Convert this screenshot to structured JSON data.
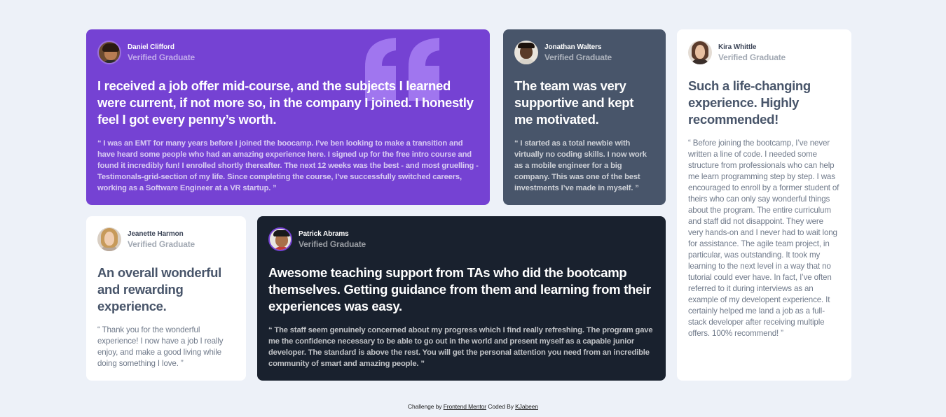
{
  "cards": {
    "daniel": {
      "name": "Daniel Clifford",
      "role": "Verified Graduate",
      "headline": "I received a job offer mid-course, and the subjects I learned were current, if not more so, in the company I joined. I honestly feel I got every penny’s worth.",
      "quote": "“ I was an EMT for many years before I joined the boocamp. I’ve ben looking to make a transition and have heard some people who had an amazing experience here. I signed up for the free intro course and found it incredibly fun! I enrolled shortly thereafter. The next 12 weeks was the best - and most gruelling - Testimonals-grid-section of my life. Since completing the course, I’ve successfully switched careers, working as a Software Engineer at a VR startup. ”"
    },
    "jonathan": {
      "name": "Jonathan Walters",
      "role": "Verified Graduate",
      "headline": "The team was very supportive and kept me motivated.",
      "quote": "“ I started as a total newbie with virtually no coding skills. I now work as a mobile engineer for a big company. This was one of the best investments I’ve made in myself. ”"
    },
    "kira": {
      "name": "Kira Whittle",
      "role": "Verified Graduate",
      "headline": "Such a life-changing experience. Highly recommended!",
      "quote": "“ Before joining the bootcamp, I’ve never written a line of code. I needed some structure from professionals who can help me learn programming step by step. I was encouraged to enroll by a former student of theirs who can only say wonderful things about the program. The entire curriculum and staff did not disappoint. They were very hands-on and I never had to wait long for assistance. The agile team project, in particular, was outstanding. It took my learning to the next level in a way that no tutorial could ever have. In fact, I’ve often referred to it during interviews as an example of my developent experience. It certainly helped me land a job as a full-stack developer after receiving multiple offers. 100% recommend! ”"
    },
    "jeanette": {
      "name": "Jeanette Harmon",
      "role": "Verified Graduate",
      "headline": "An overall wonderful and rewarding experience.",
      "quote": "“ Thank you for the wonderful experience! I now have a job I really enjoy, and make a good living while doing something I love. ”"
    },
    "patrick": {
      "name": "Patrick Abrams",
      "role": "Verified Graduate",
      "headline": "Awesome teaching support from TAs who did the bootcamp themselves. Getting guidance from them and learning from their experiences was easy.",
      "quote": "“ The staff seem genuinely concerned about my progress which I find really refreshing. The program gave me the confidence necessary to be able to go out in the world and present myself as a capable junior developer. The standard is above the rest. You will get the personal attention you need from an incredible community of smart and amazing people. ”"
    }
  },
  "footer": {
    "prefix": "Challenge by",
    "link1": "Frontend Mentor",
    "middle": "Coded By",
    "link2": "KJabeen"
  },
  "colors": {
    "background": "#edf1f8",
    "purple": "#7542d3",
    "slate": "#48556a",
    "dark": "#19212e",
    "white": "#ffffff"
  }
}
